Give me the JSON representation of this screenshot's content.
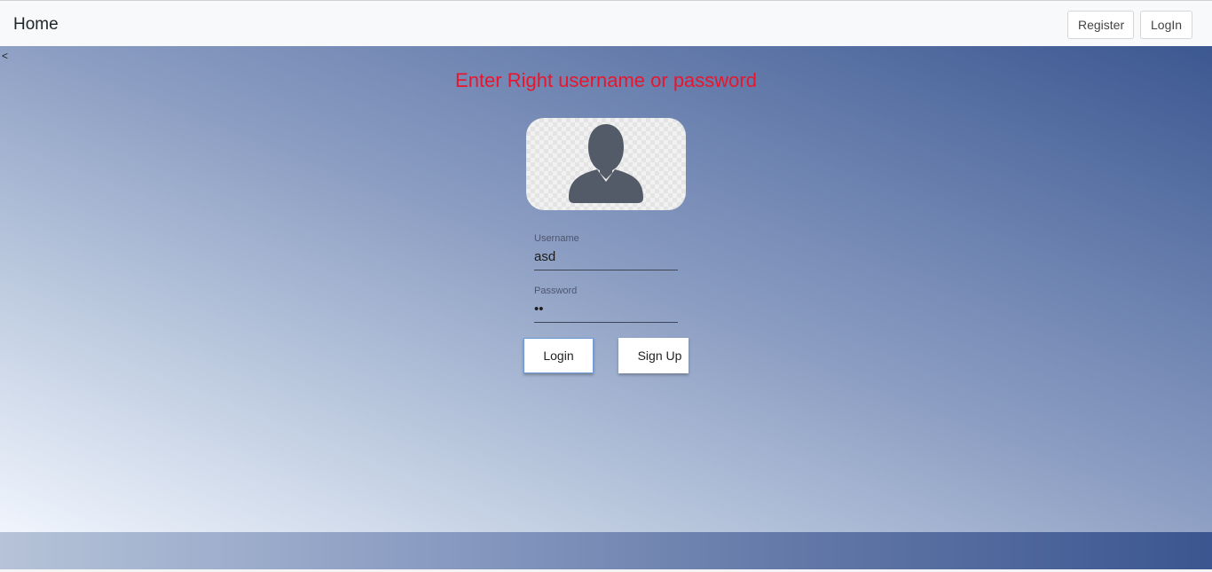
{
  "navbar": {
    "brand": "Home",
    "register_label": "Register",
    "login_label": "LogIn"
  },
  "hero": {
    "back_mark": "<",
    "error_message": "Enter Right username or password",
    "avatar_icon": "user-silhouette-icon",
    "username": {
      "label": "Username",
      "value": "asd"
    },
    "password": {
      "label": "Password",
      "value": "as"
    },
    "login_button": "Login",
    "signup_button": "Sign Up"
  },
  "colors": {
    "error": "#e8162c",
    "gradient_light": "#f0f5fd",
    "gradient_dark": "#3c5891",
    "avatar": "#545b68"
  }
}
